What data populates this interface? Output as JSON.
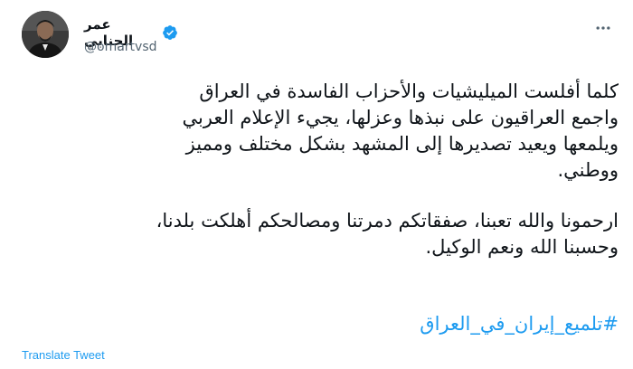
{
  "author": {
    "display_name": "عمر الجنابي",
    "handle": "@omartvsd",
    "verified": true
  },
  "tweet": {
    "paragraphs": [
      "كلما أفلست الميليشيات والأحزاب الفاسدة في العراق\nواجمع العراقيون على نبذها وعزلها، يجيء الإعلام العربي\nويلمعها ويعيد تصديرها إلى المشهد بشكل مختلف ومميز\nووطني.",
      "ارحمونا والله تعبنا، صفقاتكم دمرتنا ومصالحكم أهلكت بلدنا،\nوحسبنا الله ونعم الوكيل."
    ],
    "hashtag": "#تلميع_إيران_في_العراق"
  },
  "actions": {
    "translate_label": "Translate Tweet",
    "more_icon": "more-horizontal-icon"
  },
  "colors": {
    "text": "#0f1419",
    "secondary": "#536471",
    "accent": "#1d9bf0"
  }
}
